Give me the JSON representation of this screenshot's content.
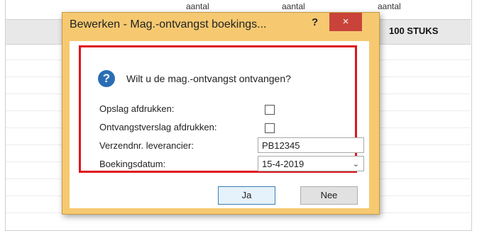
{
  "background": {
    "column_headers": [
      "aantal",
      "aantal",
      "aantal"
    ],
    "quantity": "100 STUKS"
  },
  "dialog": {
    "title": "Bewerken - Mag.-ontvangst boekings...",
    "help_label": "?",
    "close_label": "×",
    "question": "Wilt u de mag.-ontvangst ontvangen?",
    "question_icon": "question-icon",
    "fields": {
      "print_label_label": "Opslag afdrukken:",
      "print_label_checked": false,
      "print_receipt_label": "Ontvangstverslag afdrukken:",
      "print_receipt_checked": false,
      "shipment_no_label": "Verzendnr. leverancier:",
      "shipment_no_value": "PB12345",
      "posting_date_label": "Boekingsdatum:",
      "posting_date_value": "15-4-2019"
    },
    "buttons": {
      "yes": "Ja",
      "no": "Nee"
    },
    "colors": {
      "frame": "#f6c971",
      "close": "#c9433b",
      "highlight": "#e0161c",
      "icon": "#2a6db5"
    }
  }
}
